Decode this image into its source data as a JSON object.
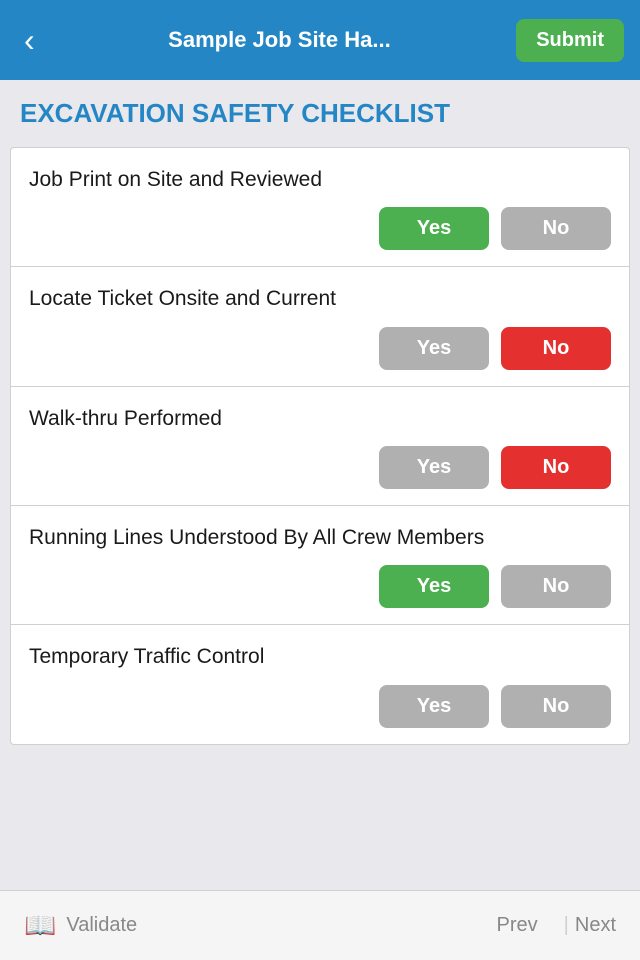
{
  "header": {
    "back_icon": "‹",
    "title": "Sample Job Site Ha...",
    "submit_label": "Submit"
  },
  "page_title": "EXCAVATION SAFETY CHECKLIST",
  "checklist": {
    "items": [
      {
        "id": "item1",
        "label": "Job Print on Site and Reviewed",
        "yes_active": true,
        "no_active": false
      },
      {
        "id": "item2",
        "label": "Locate Ticket Onsite and Current",
        "yes_active": false,
        "no_active": true
      },
      {
        "id": "item3",
        "label": "Walk-thru Performed",
        "yes_active": false,
        "no_active": true
      },
      {
        "id": "item4",
        "label": "Running Lines Understood By All Crew Members",
        "yes_active": true,
        "no_active": false
      },
      {
        "id": "item5",
        "label": "Temporary Traffic Control",
        "yes_active": false,
        "no_active": false
      }
    ]
  },
  "buttons": {
    "yes_label": "Yes",
    "no_label": "No"
  },
  "bottom_nav": {
    "validate_label": "Validate",
    "prev_label": "Prev",
    "next_label": "Next"
  }
}
